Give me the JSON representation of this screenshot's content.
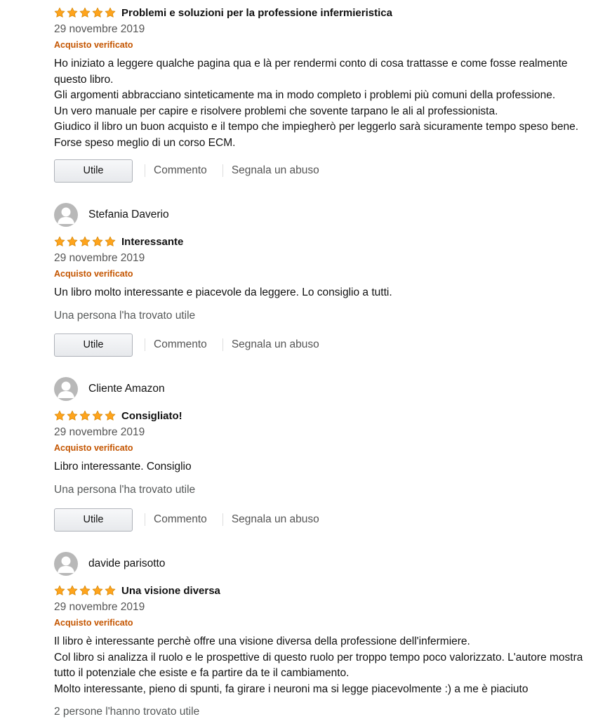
{
  "reviews": [
    {
      "author": "",
      "stars": 5,
      "title": "Problemi e soluzioni per la professione infermieristica",
      "date": "29 novembre 2019",
      "verified": "Acquisto verificato",
      "body": [
        "Ho iniziato a leggere qualche pagina qua e là per rendermi conto di cosa trattasse e come fosse realmente questo libro.",
        "Gli argomenti abbracciano sinteticamente ma in modo completo i problemi più comuni della professione.",
        "Un vero manuale per capire e risolvere problemi che sovente tarpano le ali al professionista.",
        "Giudico il libro un buon acquisto e il tempo che impiegherò per leggerlo sarà sicuramente tempo speso bene. Forse speso meglio di un corso ECM."
      ],
      "helpful_text": ""
    },
    {
      "author": "Stefania Daverio",
      "stars": 5,
      "title": "Interessante",
      "date": "29 novembre 2019",
      "verified": "Acquisto verificato",
      "body": [
        "Un libro molto interessante e piacevole da leggere. Lo consiglio a tutti."
      ],
      "helpful_text": "Una persona l'ha trovato utile"
    },
    {
      "author": "Cliente Amazon",
      "stars": 5,
      "title": "Consigliato!",
      "date": "29 novembre 2019",
      "verified": "Acquisto verificato",
      "body": [
        "Libro interessante. Consiglio"
      ],
      "helpful_text": "Una persona l'ha trovato utile"
    },
    {
      "author": "davide parisotto",
      "stars": 5,
      "title": "Una visione diversa",
      "date": "29 novembre 2019",
      "verified": "Acquisto verificato",
      "body": [
        "Il libro è interessante perchè offre una visione diversa della professione dell'infermiere.",
        "Col libro si analizza il ruolo e le prospettive di questo ruolo per troppo tempo poco valorizzato. L'autore mostra tutto il potenziale che esiste e fa partire da te il cambiamento.",
        "Molto interessante, pieno di spunti, fa girare i neuroni ma si legge piacevolmente :) a me è piaciuto"
      ],
      "helpful_text": "2 persone l'hanno trovato utile"
    }
  ],
  "actions": {
    "helpful_button": "Utile",
    "comment_link": "Commento",
    "report_link": "Segnala un abuso"
  },
  "colors": {
    "star": "#ffa41c",
    "verified": "#c45500",
    "muted": "#555555"
  }
}
